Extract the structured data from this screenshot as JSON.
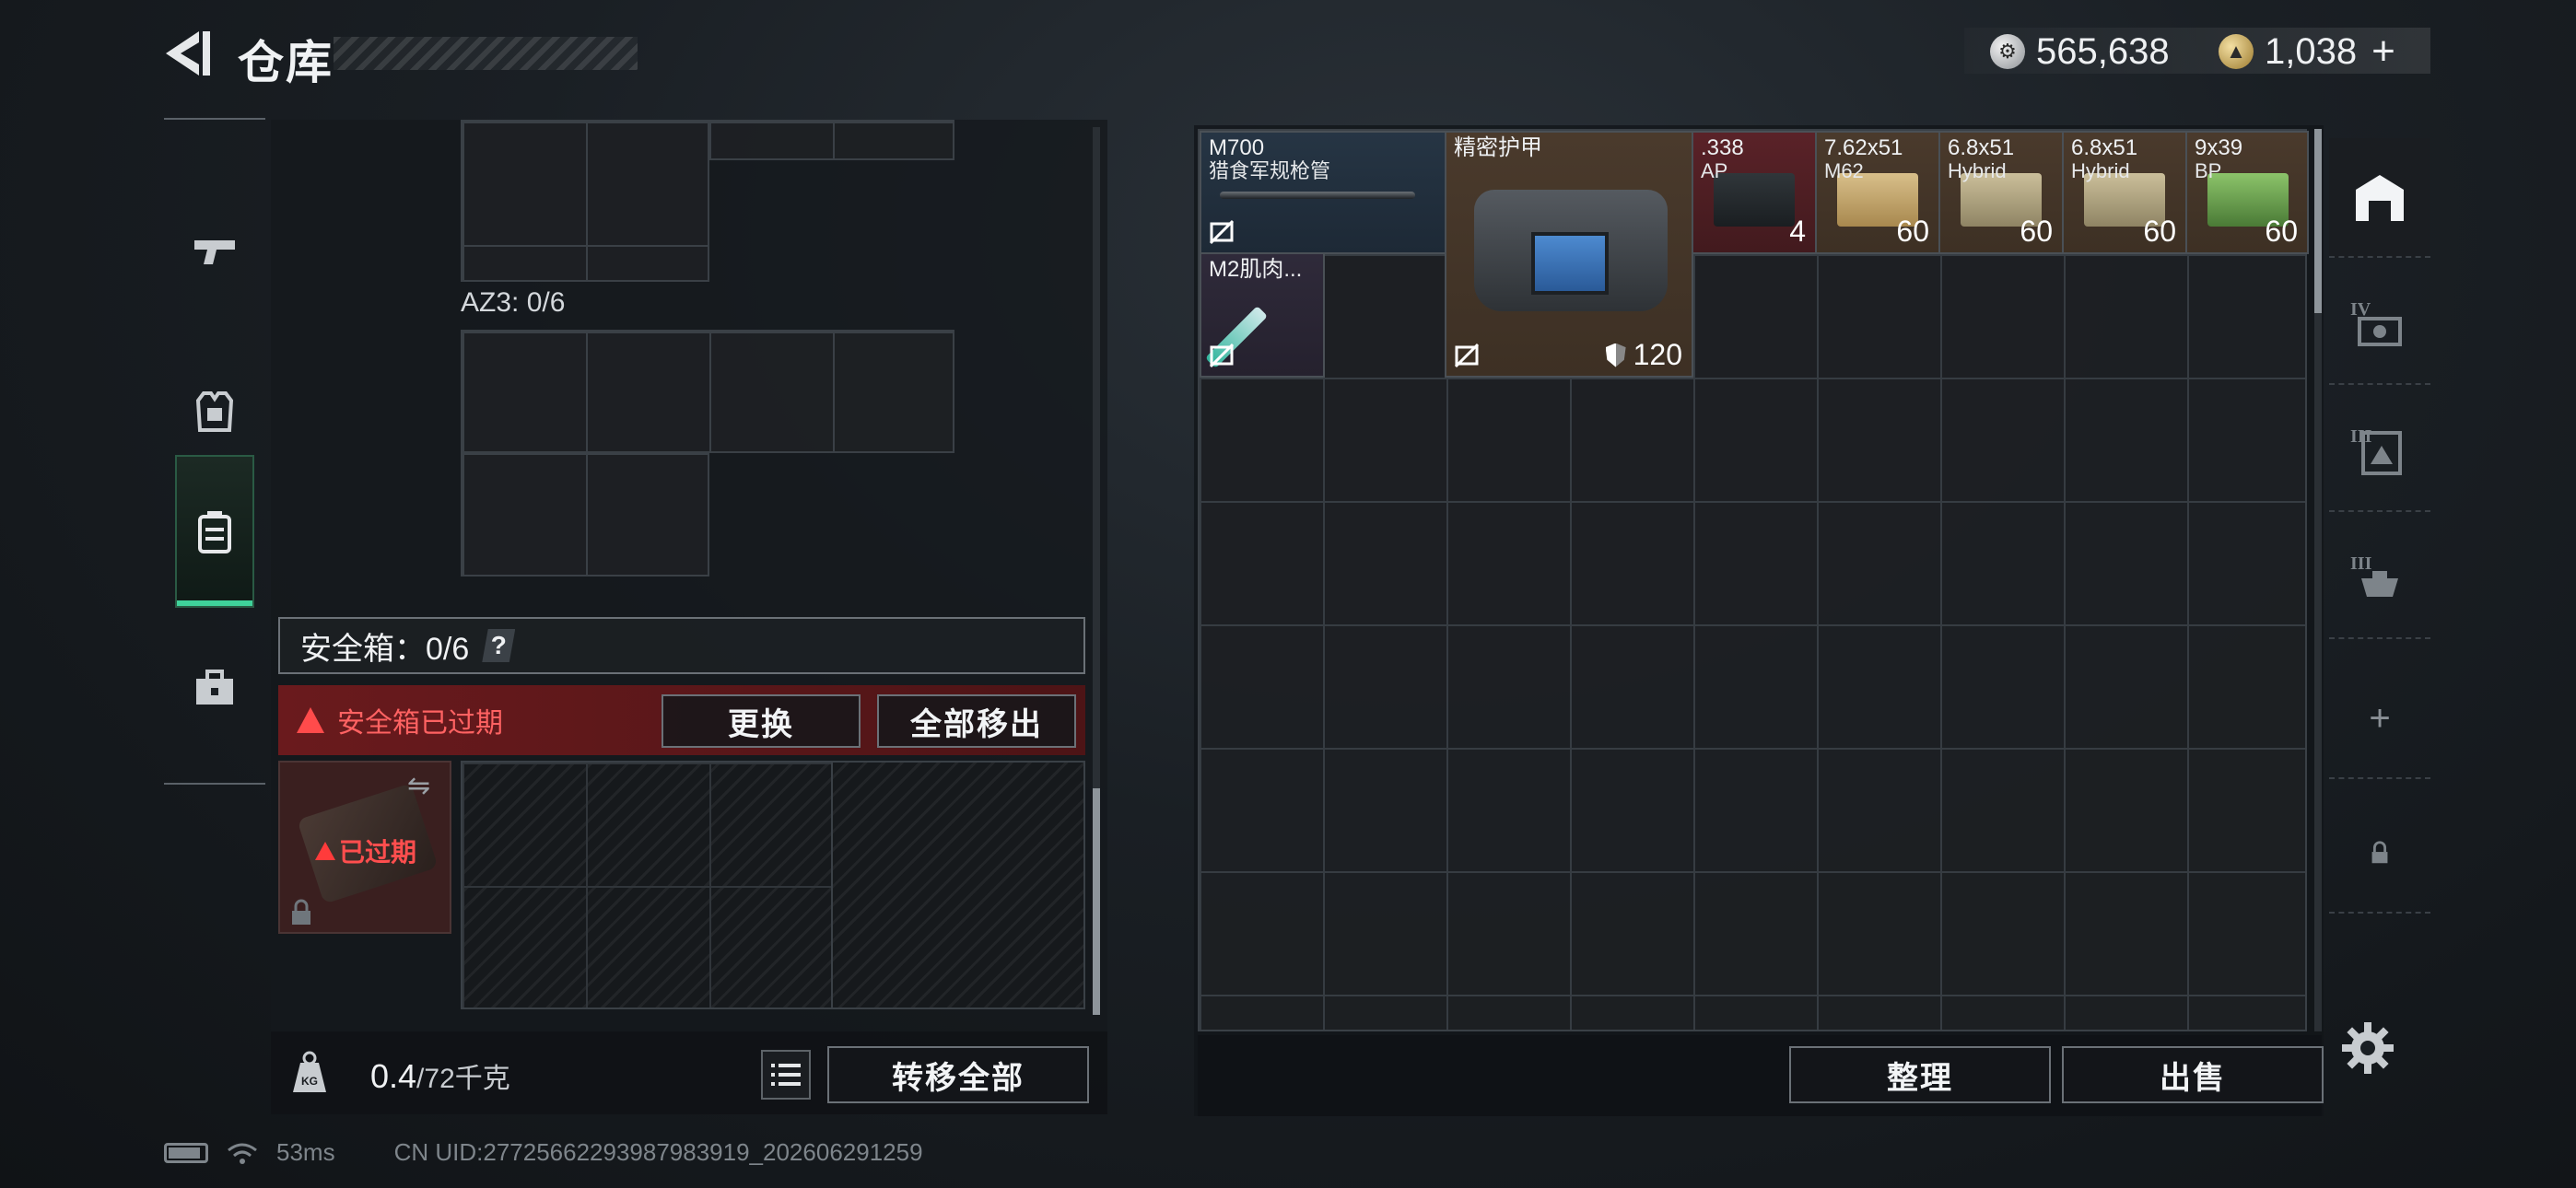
{
  "header": {
    "title": "仓库",
    "currency_silver": "565,638",
    "currency_gold": "1,038",
    "gold_add_label": "+"
  },
  "left_sidebar": {
    "items": [
      {
        "name": "weapons",
        "icon": "pistol-icon"
      },
      {
        "name": "armor",
        "icon": "vest-icon"
      },
      {
        "name": "backpack",
        "icon": "backpack-icon",
        "active": true
      },
      {
        "name": "supplies",
        "icon": "toolbox-icon"
      }
    ]
  },
  "backpack": {
    "az3_label": "AZ3: 0/6",
    "safe_box_label": "安全箱：0/6",
    "safe_box_help": "?",
    "expired_notice": "安全箱已过期",
    "replace_label": "更换",
    "remove_all_label": "全部移出",
    "safe_item_status": "已过期",
    "weight_value": "0.4",
    "weight_capacity": "/72千克",
    "transfer_all_label": "转移全部"
  },
  "warehouse": {
    "items": [
      {
        "name": "M700",
        "sub": "猎食军规枪管",
        "count": "",
        "no_sell": true
      },
      {
        "name": "精密护甲",
        "sub": "",
        "durability": "120",
        "no_sell": true
      },
      {
        "name": ".338",
        "sub": "AP",
        "count": "4"
      },
      {
        "name": "7.62x51",
        "sub": "M62",
        "count": "60"
      },
      {
        "name": "6.8x51",
        "sub": "Hybrid",
        "count": "60"
      },
      {
        "name": "6.8x51",
        "sub": "Hybrid",
        "count": "60"
      },
      {
        "name": "9x39",
        "sub": "BP",
        "count": "60"
      },
      {
        "name": "M2肌肉...",
        "sub": "",
        "count": "",
        "no_sell": true
      }
    ],
    "sort_label": "整理",
    "sell_label": "出售"
  },
  "right_tabs": [
    {
      "label": "",
      "icon": "warehouse-icon"
    },
    {
      "label": "IV",
      "icon": "storage-tier4-icon"
    },
    {
      "label": "III",
      "icon": "storage-tier3-icon"
    },
    {
      "label": "III",
      "icon": "storage-tier3b-icon"
    },
    {
      "label": "+",
      "icon": "add-icon"
    },
    {
      "label": "",
      "icon": "lock-icon"
    }
  ],
  "status_bar": {
    "ping": "53ms",
    "uid": "CN UID:27725662293987983919_202606291259"
  },
  "colors": {
    "accent_green": "#3fd29a",
    "expired_red": "#ff4b4b"
  }
}
